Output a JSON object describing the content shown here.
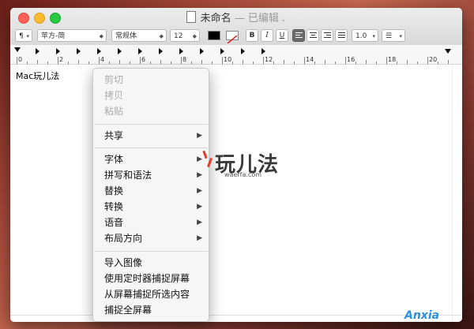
{
  "window": {
    "title": "未命名",
    "edited": "— 已编辑",
    "chevron": "⌄"
  },
  "toolbar": {
    "paragraph_style": "¶",
    "font_family": "苹方-简",
    "font_style": "常规体",
    "font_size": "12",
    "text_color": "#000000",
    "bold": "B",
    "italic": "I",
    "underline": "U",
    "line_spacing": "1.0",
    "list_style": "☰"
  },
  "ruler": {
    "labels": [
      "0",
      "2",
      "4",
      "6",
      "8",
      "10",
      "12",
      "14",
      "16",
      "18",
      "20"
    ]
  },
  "document": {
    "text": "Mac玩儿法"
  },
  "context_menu": {
    "cut": "剪切",
    "copy": "拷贝",
    "paste": "粘贴",
    "share": "共享",
    "font": "字体",
    "spelling": "拼写和语法",
    "substitutions": "替换",
    "transformations": "转换",
    "speech": "语音",
    "layout_direction": "布局方向",
    "import_image": "导入图像",
    "timed_capture": "使用定时器捕捉屏幕",
    "capture_selection": "从屏幕捕捉所选内容",
    "capture_full": "捕捉全屏幕",
    "submenu_arrow": "▶"
  },
  "watermarks": {
    "site_name": "玩儿法",
    "site_url": "waerfa.com",
    "brand": "Anxia"
  },
  "colors": {
    "close": "#fc5f57",
    "minimize": "#fdbc2e",
    "maximize": "#28c840",
    "brand_blue": "#2e90d9"
  }
}
